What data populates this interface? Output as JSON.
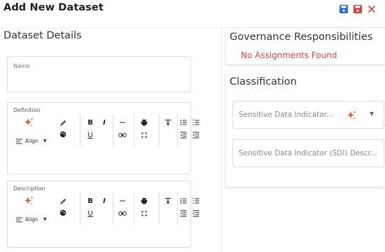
{
  "header": {
    "title": "Add New Dataset",
    "icons": [
      "save-icon",
      "save-icon",
      "close-icon"
    ],
    "colors": {
      "save_primary": "#1e6fd9",
      "save_secondary": "#e53935",
      "close": "#e53935"
    }
  },
  "dataset_details": {
    "title": "Dataset Details",
    "name_label": "Name",
    "definition_label": "Definition",
    "description_label": "Description",
    "toolbar": {
      "bold": "B",
      "italic": "I",
      "underline": "U",
      "align": "Align"
    }
  },
  "governance": {
    "title": "Governance Responsibilities",
    "empty_text": "No Assignments Found"
  },
  "classification": {
    "title": "Classification",
    "sdi_placeholder": "Sensitive Data Indicator...",
    "sdi_description_placeholder": "Sensitive Data Indicator (SDI) Descr..."
  },
  "colors": {
    "sparkle": "#f4511e",
    "error": "#f44336"
  }
}
